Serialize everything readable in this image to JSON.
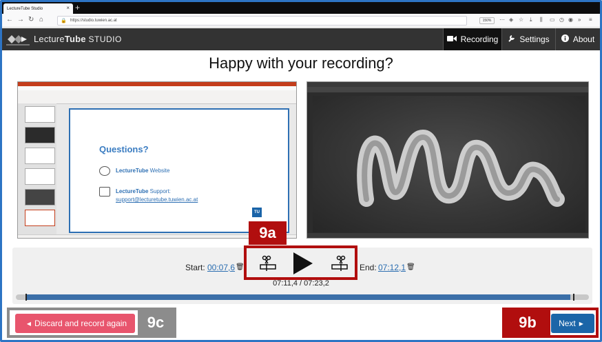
{
  "browser": {
    "tab_title": "LectureTube Studio",
    "url": "https://studio.tuwien.ac.at",
    "zoom": "150%"
  },
  "header": {
    "brand_prefix": "Lecture",
    "brand_bold": "Tube",
    "brand_suffix": " STUDIO",
    "nav": [
      {
        "label": "Recording",
        "icon": "video-camera-icon",
        "active": true
      },
      {
        "label": "Settings",
        "icon": "wrench-icon",
        "active": false
      },
      {
        "label": "About",
        "icon": "info-icon",
        "active": false
      }
    ]
  },
  "main": {
    "title": "Happy with your recording?"
  },
  "slide": {
    "heading": "Questions?",
    "website_bold": "LectureTube",
    "website_rest": " Website",
    "support_bold": "LectureTube",
    "support_rest": " Support:",
    "support_email": "support@lecturetube.tuwien.ac.at",
    "logo_text": "TU"
  },
  "player": {
    "start_label": "Start:",
    "start_time": "00:07,6",
    "end_label": "End:",
    "end_time": "07:12,1",
    "timecode": "07:11,4 / 07:23,2",
    "progress": 0.995
  },
  "callouts": {
    "a": "9a",
    "b": "9b",
    "c": "9c"
  },
  "buttons": {
    "discard": "Discard and record again",
    "next": "Next"
  },
  "colors": {
    "accent_blue": "#1b65a8",
    "discard_pink": "#e8556d",
    "callout_red": "#b10e0e",
    "callout_grey": "#8c8c8c",
    "header_dark": "#333333"
  }
}
